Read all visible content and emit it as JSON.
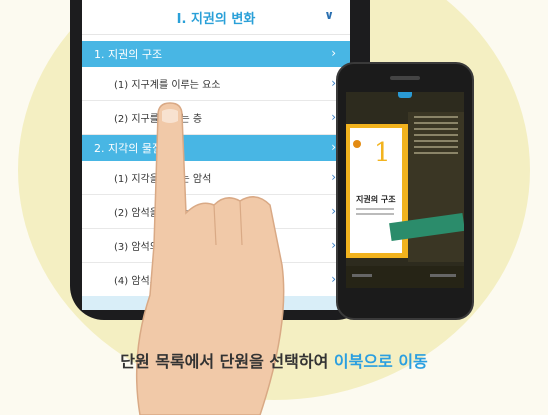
{
  "chapter": {
    "title": "Ⅰ. 지권의 변화"
  },
  "sections": [
    {
      "label": "1.  지권의 구조",
      "items": [
        "(1) 지구계를 이루는 요소",
        "(2) 지구를 이루는 층"
      ]
    },
    {
      "label": "2.  지각의 물질",
      "items": [
        "(1) 지각을 이루는 암석",
        "(2) 암석을 이루는 광물",
        "(3) 암석의 순환",
        "(4) 암석의 이용"
      ]
    }
  ],
  "preview": {
    "cover_number": "1",
    "cover_title": "지권의 구조"
  },
  "caption": {
    "main": "단원 목록에서 단원을 선택하여",
    "highlight": "이북으로 이동"
  },
  "colors": {
    "accent": "#48b6e4",
    "highlight": "#2b9fe0",
    "cover": "#f2b31e"
  }
}
